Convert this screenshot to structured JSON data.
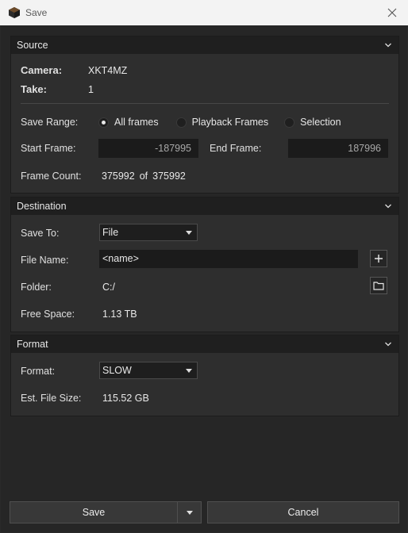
{
  "window": {
    "title": "Save"
  },
  "source": {
    "header": "Source",
    "camera_label": "Camera:",
    "camera_value": "XKT4MZ",
    "take_label": "Take:",
    "take_value": "1",
    "save_range_label": "Save Range:",
    "range_options": [
      "All frames",
      "Playback Frames",
      "Selection"
    ],
    "range_selected": "All frames",
    "start_frame_label": "Start Frame:",
    "start_frame_value": "-187995",
    "end_frame_label": "End Frame:",
    "end_frame_value": "187996",
    "frame_count_label": "Frame Count:",
    "frame_count_value": "375992",
    "frame_count_of": "of",
    "frame_count_total": "375992"
  },
  "destination": {
    "header": "Destination",
    "save_to_label": "Save To:",
    "save_to_value": "File",
    "file_name_label": "File Name:",
    "file_name_value": "<name>",
    "folder_label": "Folder:",
    "folder_value": "C:/",
    "free_space_label": "Free Space:",
    "free_space_value": "1.13 TB"
  },
  "format": {
    "header": "Format",
    "format_label": "Format:",
    "format_value": "SLOW",
    "est_size_label": "Est. File Size:",
    "est_size_value": "115.52 GB"
  },
  "footer": {
    "save_label": "Save",
    "cancel_label": "Cancel"
  },
  "icons": {
    "app": "cube-icon",
    "close": "close-icon",
    "collapse": "chevron-down-icon",
    "add": "plus-icon",
    "folder": "folder-icon",
    "dropdown": "dropdown-arrow-icon"
  }
}
